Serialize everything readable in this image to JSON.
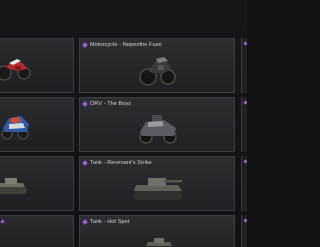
{
  "screen": "vehicle-camo-selection",
  "colors": {
    "rarity_purple": "#a35bd6",
    "card_bg": "#24262a",
    "card_border": "#3a3d42",
    "title_text": "#d7d8da"
  },
  "cards": [
    {
      "title": "Motorcycle - Nepenthe Fuse",
      "vehicle": "motorcycle"
    },
    {
      "title": "ORV - The Boys",
      "vehicle": "orv"
    },
    {
      "title": "Tank - Revenant's Strike",
      "vehicle": "tank"
    },
    {
      "title": "Tank - Hot Spot",
      "vehicle": "tank"
    }
  ],
  "left_cards": [
    {
      "vehicle": "motorcycle-red"
    },
    {
      "vehicle": "orv-blue"
    },
    {
      "vehicle": "tank"
    },
    {
      "vehicle": "partial"
    }
  ]
}
